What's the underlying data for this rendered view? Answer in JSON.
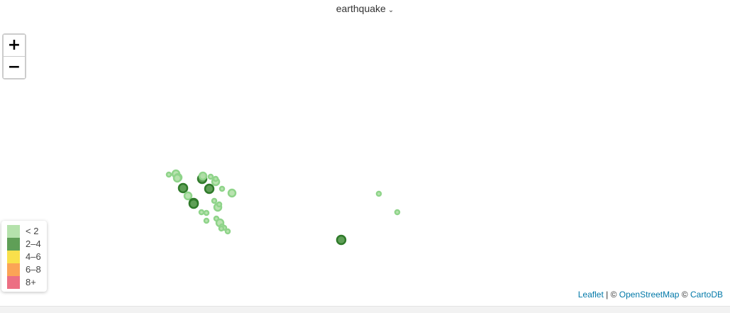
{
  "header": {
    "title": "earthquake",
    "chevron_icon": "chevron-down-icon"
  },
  "zoom": {
    "in_label": "+",
    "out_label": "−"
  },
  "legend": {
    "items": [
      {
        "label": "< 2",
        "color": "#b5e2ac"
      },
      {
        "label": "2–4",
        "color": "#5f9f57"
      },
      {
        "label": "4–6",
        "color": "#f9e04b"
      },
      {
        "label": "6–8",
        "color": "#fba456"
      },
      {
        "label": "8+",
        "color": "#ec6f83"
      }
    ]
  },
  "attribution": {
    "leaflet": "Leaflet",
    "sep1": " | © ",
    "osm": "OpenStreetMap",
    "sep2": " © ",
    "carto": "CartoDB"
  },
  "markers": [
    {
      "class": "< 2",
      "size": "small"
    },
    {
      "class": "< 2",
      "size": "medium"
    },
    {
      "class": "< 2",
      "size": "medium"
    },
    {
      "class": "< 2",
      "size": "medium"
    },
    {
      "class": "2–4",
      "size": "large"
    },
    {
      "class": "2–4",
      "size": "large"
    },
    {
      "class": "< 2",
      "size": "medium"
    },
    {
      "class": "< 2",
      "size": "small"
    },
    {
      "class": "< 2",
      "size": "medium"
    },
    {
      "class": "2–4",
      "size": "large"
    },
    {
      "class": "< 2",
      "size": "small"
    },
    {
      "class": "< 2",
      "size": "small"
    },
    {
      "class": "< 2",
      "size": "medium"
    },
    {
      "class": "2–4",
      "size": "large"
    },
    {
      "class": "< 2",
      "size": "small"
    },
    {
      "class": "< 2",
      "size": "medium"
    },
    {
      "class": "< 2",
      "size": "small"
    },
    {
      "class": "< 2",
      "size": "small"
    },
    {
      "class": "< 2",
      "size": "small"
    },
    {
      "class": "< 2",
      "size": "small"
    },
    {
      "class": "< 2",
      "size": "small"
    },
    {
      "class": "< 2",
      "size": "medium"
    },
    {
      "class": "< 2",
      "size": "small"
    },
    {
      "class": "< 2",
      "size": "small"
    },
    {
      "class": "< 2",
      "size": "small"
    },
    {
      "class": "< 2",
      "size": "small"
    },
    {
      "class": "2–4",
      "size": "large"
    },
    {
      "class": "< 2",
      "size": "small"
    },
    {
      "class": "< 2",
      "size": "small"
    },
    {
      "class": "2–4",
      "size": "large"
    },
    {
      "class": "< 2",
      "size": "medium"
    },
    {
      "class": "< 2",
      "size": "medium"
    }
  ]
}
